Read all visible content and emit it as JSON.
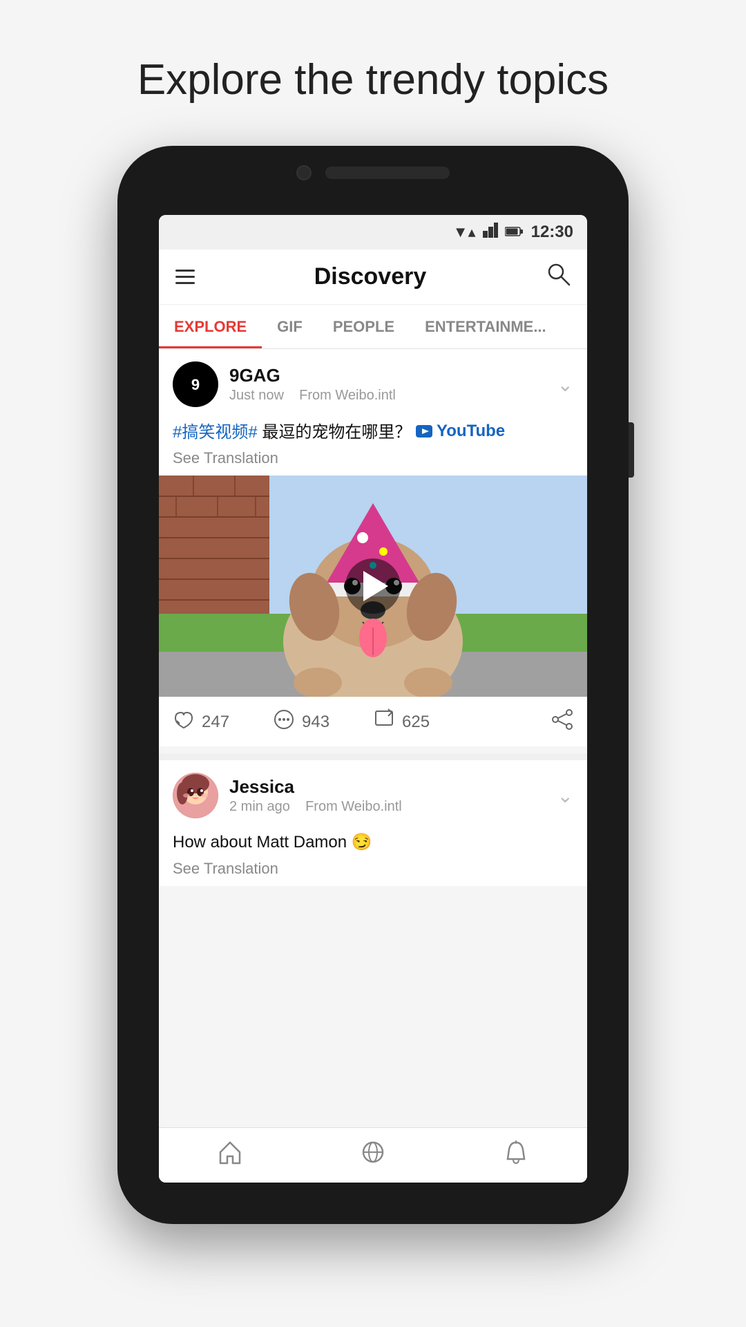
{
  "page": {
    "title": "Explore the trendy topics"
  },
  "status_bar": {
    "time": "12:30",
    "wifi": "▼",
    "signal": "▲",
    "battery": "🔋"
  },
  "header": {
    "title": "Discovery",
    "search_label": "search"
  },
  "tabs": [
    {
      "id": "explore",
      "label": "EXPLORE",
      "active": true
    },
    {
      "id": "gif",
      "label": "GIF",
      "active": false
    },
    {
      "id": "people",
      "label": "PEOPLE",
      "active": false
    },
    {
      "id": "entertainment",
      "label": "ENTERTAINME...",
      "active": false
    }
  ],
  "posts": [
    {
      "id": "post1",
      "username": "9GAG",
      "time": "Just now",
      "source": "From Weibo.intl",
      "text_chinese": "#搞笑视频#  最逗的宠物在哪里？",
      "youtube_text": "YouTube",
      "see_translation": "See Translation",
      "likes": "247",
      "comments": "943",
      "shares": "625"
    },
    {
      "id": "post2",
      "username": "Jessica",
      "time": "2 min ago",
      "source": "From Weibo.intl",
      "text": "How about Matt Damon 😏",
      "see_translation": "See Translation"
    }
  ],
  "bottom_nav": [
    {
      "id": "home",
      "icon": "home",
      "label": "Home"
    },
    {
      "id": "discover",
      "icon": "discover",
      "label": "Discover"
    },
    {
      "id": "notifications",
      "icon": "bell",
      "label": "Notifications"
    }
  ],
  "colors": {
    "accent_red": "#e53935",
    "tab_active": "#e53935",
    "hashtag_blue": "#1565c0",
    "link_blue": "#1565c0"
  }
}
